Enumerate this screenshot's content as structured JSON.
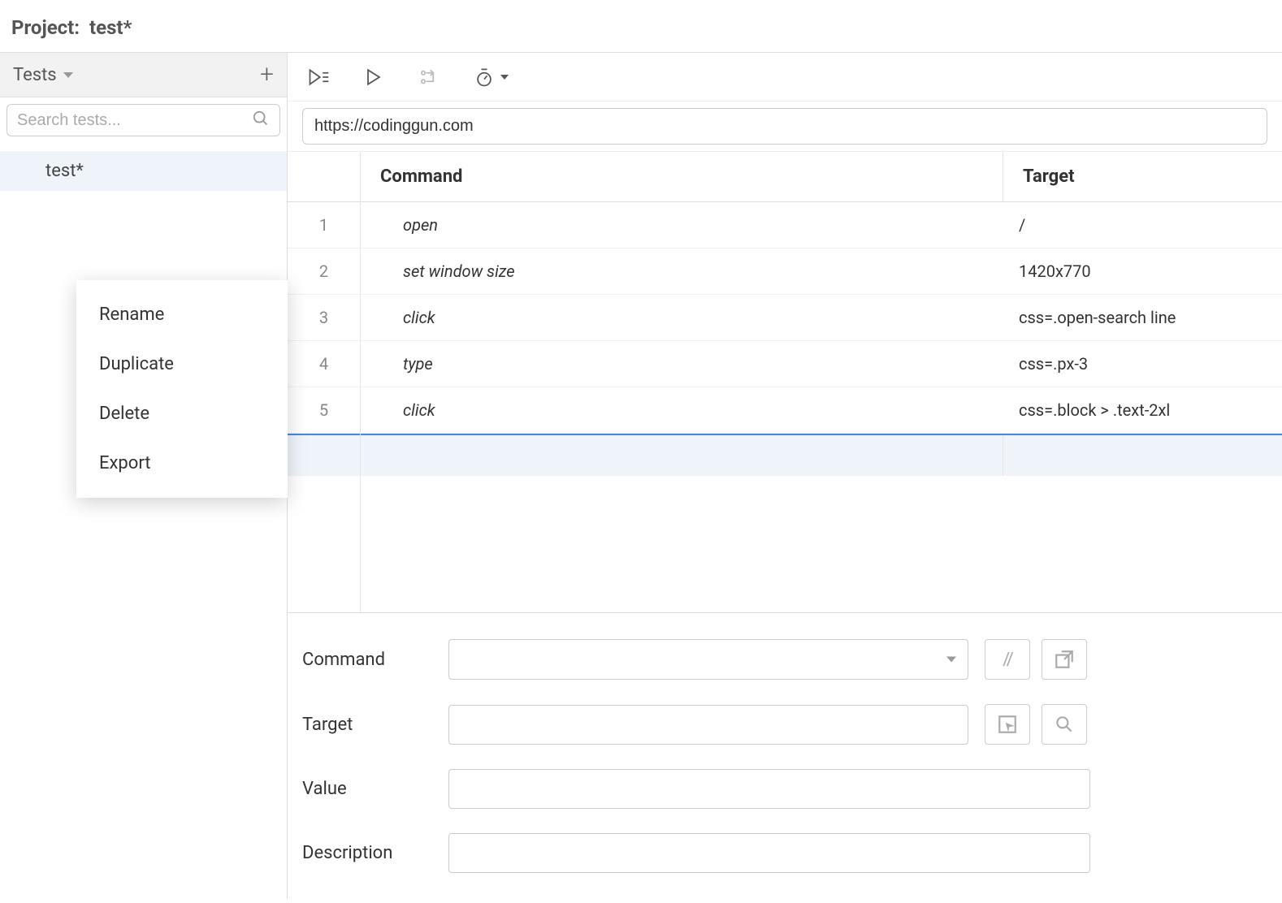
{
  "header": {
    "project_label": "Project:",
    "project_name": "test*"
  },
  "sidebar": {
    "title": "Tests",
    "search_placeholder": "Search tests...",
    "tests": [
      {
        "name": "test*"
      }
    ]
  },
  "context_menu": {
    "items": [
      {
        "label": "Rename"
      },
      {
        "label": "Duplicate"
      },
      {
        "label": "Delete"
      },
      {
        "label": "Export"
      }
    ]
  },
  "url": "https://codinggun.com",
  "table": {
    "headers": {
      "command": "Command",
      "target": "Target"
    },
    "rows": [
      {
        "n": "1",
        "command": "open",
        "target": "/"
      },
      {
        "n": "2",
        "command": "set window size",
        "target": "1420x770"
      },
      {
        "n": "3",
        "command": "click",
        "target": "css=.open-search line"
      },
      {
        "n": "4",
        "command": "type",
        "target": "css=.px-3"
      },
      {
        "n": "5",
        "command": "click",
        "target": "css=.block > .text-2xl"
      }
    ]
  },
  "detail": {
    "labels": {
      "command": "Command",
      "target": "Target",
      "value": "Value",
      "description": "Description"
    },
    "command": "",
    "target": "",
    "value": "",
    "description": ""
  }
}
